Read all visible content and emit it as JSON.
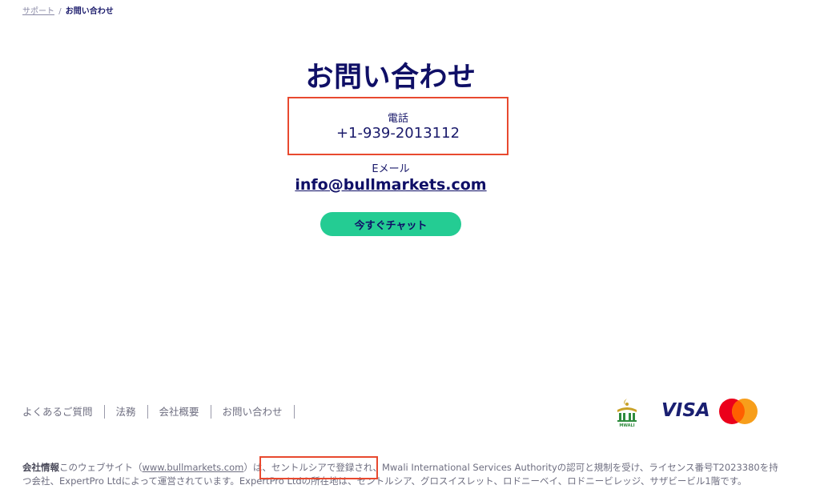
{
  "breadcrumb": {
    "parent": "サポート",
    "separator": "/",
    "current": "お問い合わせ"
  },
  "title": "お問い合わせ",
  "phone": {
    "label": "電話",
    "number": "+1-939-2013112"
  },
  "email": {
    "label": "Eメール",
    "address": "info@bullmarkets.com"
  },
  "chat_button": "今すぐチャット",
  "footer": {
    "nav": [
      "よくあるご質問",
      "法務",
      "会社概要",
      "お問い合わせ"
    ],
    "logos": {
      "mwali_text": "MWALI",
      "visa_text": "VISA"
    },
    "company_info": {
      "title": "会社情報",
      "text1": "このウェブサイト（",
      "link": "www.bullmarkets.com",
      "text2": "）は、",
      "registered": "セントルシアで登録され、",
      "text3": "Mwali International Services Authorityの認可と規制を受け、ライセンス番号T2023380を持つ会社、ExpertPro Ltdによって運営されています。ExpertPro Ltdの所在地は、セントルシア、グロスイスレット、ロドニーベイ、ロドニービレッジ、サザビービル1階です。"
    }
  },
  "colors": {
    "navy": "#0f0f66",
    "accent_green": "#24cc93",
    "highlight_red": "#e8492f",
    "footer_gray": "#6e6e80",
    "visa_blue": "#1a1f71",
    "mc_red": "#eb001b",
    "mc_orange": "#f79e1b"
  }
}
